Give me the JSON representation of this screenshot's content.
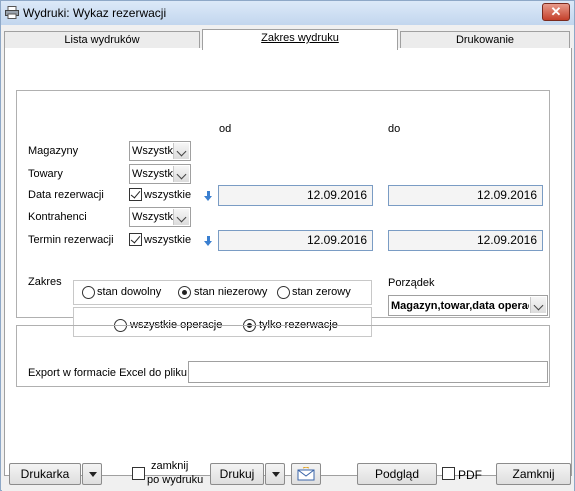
{
  "window": {
    "title": "Wydruki: Wykaz rezerwacji",
    "close_label": "✕"
  },
  "tabs": [
    {
      "label": "Lista wydruków",
      "active": false
    },
    {
      "label": "Zakres wydruku",
      "active": true
    },
    {
      "label": "Drukowanie",
      "active": false
    }
  ],
  "range": {
    "from_label": "od",
    "to_label": "do"
  },
  "filters": {
    "magazyny": {
      "label": "Magazyny",
      "value": "Wszystkie"
    },
    "towary": {
      "label": "Towary",
      "value": "Wszystkie"
    },
    "data_rezerwacji": {
      "label": "Data rezerwacji",
      "checkbox_label": "wszystkie",
      "checked": true,
      "from": "12.09.2016",
      "to": "12.09.2016"
    },
    "kontrahenci": {
      "label": "Kontrahenci",
      "value": "Wszystkie"
    },
    "termin_rezerwacji": {
      "label": "Termin rezerwacji",
      "checkbox_label": "wszystkie",
      "checked": true,
      "from": "12.09.2016",
      "to": "12.09.2016"
    }
  },
  "zakres": {
    "label": "Zakres",
    "stock_options": [
      {
        "label": "stan dowolny",
        "selected": false
      },
      {
        "label": "stan niezerowy",
        "selected": true
      },
      {
        "label": "stan zerowy",
        "selected": false
      }
    ],
    "operation_options": [
      {
        "label": "wszystkie operacje",
        "selected": false
      },
      {
        "label": "tylko rezerwacje",
        "selected": true
      }
    ]
  },
  "porzadek": {
    "label": "Porządek",
    "value": "Magazyn,towar,data operacji"
  },
  "export": {
    "label": "Export w formacie Excel do pliku",
    "value": ""
  },
  "toolbar": {
    "printer_label": "Drukarka",
    "close_after_print_label_1": "zamknij",
    "close_after_print_label_2": "po wydruku",
    "close_after_print_checked": false,
    "print_label": "Drukuj",
    "preview_label": "Podgląd",
    "pdf_label": "PDF",
    "pdf_checked": false,
    "close_label": "Zamknij"
  }
}
